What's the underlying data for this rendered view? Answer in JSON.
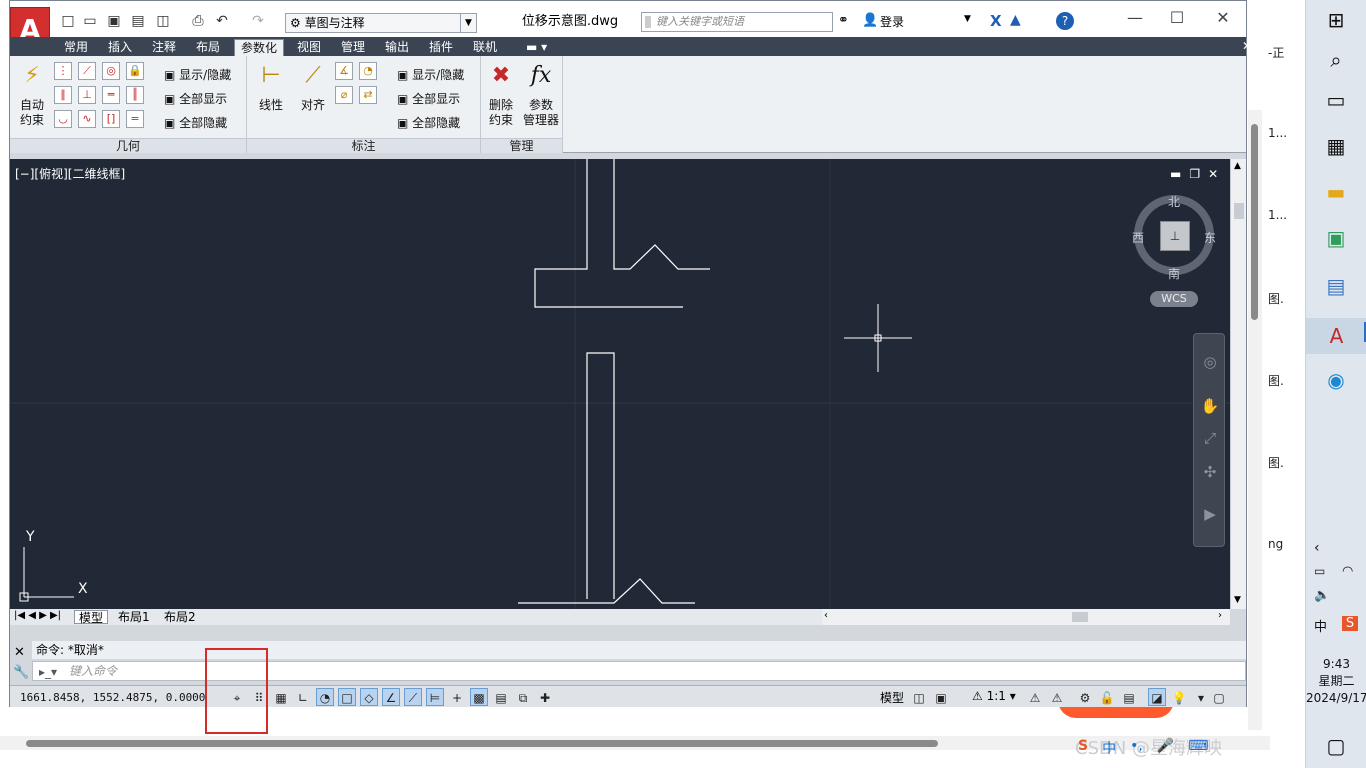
{
  "app": {
    "document_title": "位移示意图.dwg",
    "workspace": "草图与注释",
    "search_placeholder": "键入关键字或短语",
    "login": "登录"
  },
  "ribbon_tabs": [
    "常用",
    "插入",
    "注释",
    "布局",
    "参数化",
    "视图",
    "管理",
    "输出",
    "插件",
    "联机"
  ],
  "active_tab": "参数化",
  "ribbon": {
    "geometry": {
      "label": "几何",
      "auto_constrain": [
        "自动",
        "约束"
      ],
      "show_hide": "显示/隐藏",
      "show_all": "全部显示",
      "hide_all": "全部隐藏"
    },
    "dimension": {
      "label": "标注",
      "linear": "线性",
      "aligned": "对齐",
      "show_hide": "显示/隐藏",
      "show_all": "全部显示",
      "hide_all": "全部隐藏"
    },
    "manage": {
      "label": "管理",
      "delete_constraint": [
        "删除",
        "约束"
      ],
      "param_manager": [
        "参数",
        "管理器"
      ],
      "fx": "fx"
    }
  },
  "viewport": {
    "label": "[−][俯视][二维线框]",
    "compass": {
      "north": "北",
      "south": "南",
      "east": "东",
      "west": "西"
    },
    "wcs": "WCS",
    "ucs_x": "X",
    "ucs_y": "Y"
  },
  "layout_tabs": [
    "模型",
    "布局1",
    "布局2"
  ],
  "command": {
    "history": "命令: *取消*",
    "input_placeholder": "键入命令"
  },
  "status": {
    "coords": "1661.8458,  1552.4875,  0.0000",
    "model": "模型",
    "scale": "1:1"
  },
  "background_page": {
    "side_snippets": [
      "-正",
      "1...",
      "1...",
      "图.",
      "图.",
      "图.",
      "ng"
    ],
    "watermark": "CSDN @星海辉映"
  },
  "taskbar": {
    "time": "9:43",
    "weekday": "星期二",
    "date": "2024/9/17",
    "ime_lang": "中"
  },
  "colors": {
    "viewport_bg": "#222936",
    "ribbon_tab_bar": "#3b4453",
    "highlight_box": "#d62b2b",
    "autocad_red": "#d32f2f"
  }
}
